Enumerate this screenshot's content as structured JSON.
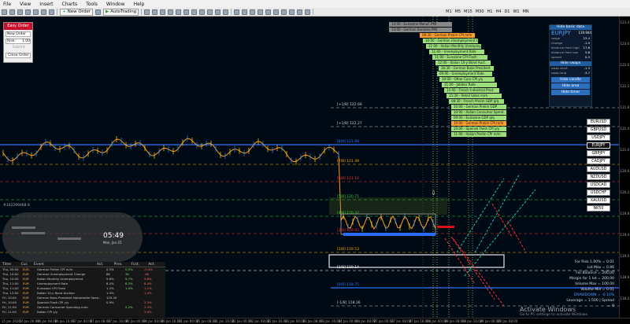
{
  "menu": [
    "File",
    "View",
    "Insert",
    "Charts",
    "Tools",
    "Window",
    "Help"
  ],
  "toolbar": {
    "new_order": "New Order",
    "auto_trading": "AutoTrading"
  },
  "timeframes": [
    "M1",
    "M5",
    "M15",
    "M30",
    "H1",
    "H4",
    "D1",
    "W1",
    "MN"
  ],
  "easy_order": {
    "title": "Easy Order",
    "type": "New Order",
    "risk_label": "Risk:",
    "risk_value": "1.00",
    "submit": "Submit",
    "close": "Close Order"
  },
  "news": [
    {
      "text": "13:00 - Eurozone Manuf. PMI",
      "color": "#888888"
    },
    {
      "text": "13:00 - German Services PMI",
      "color": "#888888"
    },
    {
      "text": "08:30 - German Prelim CPI m/m",
      "color": "#ff9f30"
    },
    {
      "text": "10:00 - German Unemployment Chan",
      "color": "#9adf7a"
    },
    {
      "text": "11:00 - Italian Monthly Unemploy.",
      "color": "#9adf7a"
    },
    {
      "text": "11:00 - Unemployment Rate",
      "color": "#9adf7a"
    },
    {
      "text": "11:00 - Eurozone CPI Flash",
      "color": "#9adf7a"
    },
    {
      "text": "12:00 - Italian 10-y Bond Auct.",
      "color": "#9adf7a"
    },
    {
      "text": "16:30 - German Bubs President",
      "color": "#9adf7a"
    },
    {
      "text": "09:00 - Unemployment Rate",
      "color": "#9adf7a"
    },
    {
      "text": "10:00 - Other Core CPI y/y",
      "color": "#9adf7a"
    },
    {
      "text": "11:00 - Jobless Rate",
      "color": "#9adf7a"
    },
    {
      "text": "15:00 - French Industrial Prod.",
      "color": "#9adf7a"
    },
    {
      "text": "15:30 - Retail Sales m/m",
      "color": "#9adf7a"
    },
    {
      "text": "08:30 - French Prelim GDP q/q",
      "color": "#9adf7a"
    },
    {
      "text": "10:00 - German Prelim GDP",
      "color": "#9adf7a"
    },
    {
      "text": "10:00 - Italian Consumer Spend.",
      "color": "#9adf7a"
    },
    {
      "text": "09:00 - Eurozone GDP q/q",
      "color": "#9adf7a"
    },
    {
      "text": "10:00 - German Prelim CPI m/m",
      "color": "#ff9f30"
    },
    {
      "text": "10:00 - Spanish Flash CPI y/y",
      "color": "#9adf7a"
    },
    {
      "text": "11:00 - Italian Prelim CPI m/m",
      "color": "#9adf7a"
    }
  ],
  "levels": [
    {
      "label": "[+1/8] 122.66",
      "color": "#cccccc"
    },
    {
      "label": "[+1/8] 122.27",
      "color": "#cccccc"
    },
    {
      "label": "[8/8] 121.88",
      "color": "#2f6fff"
    },
    {
      "label": "[7/8] 121.49",
      "color": "#ffb000"
    },
    {
      "label": "[6/8] 121.10",
      "color": "#ff3030"
    },
    {
      "label": "[5/8] 120.71",
      "color": "#3cd03c"
    },
    {
      "label": "[4/8] 120.32",
      "color": "#3cd03c"
    },
    {
      "label": "[3/8] 119.92",
      "color": "#ff3030"
    },
    {
      "label": "[2/8] 119.53",
      "color": "#ffb000"
    },
    {
      "label": "[1/8] 119.14",
      "color": "#ffffff"
    },
    {
      "label": "[0/8] 118.75",
      "color": "#2f6fff"
    },
    {
      "label": "[-1/8] 118.36",
      "color": "#cccccc"
    }
  ],
  "right_panel": {
    "hide_basic": "Hide basic data",
    "symbol": "EURJPY",
    "price": "119.944",
    "rows": [
      {
        "k": "range",
        "v": "23.4"
      },
      {
        "k": "change",
        "v": "-1.0"
      },
      {
        "k": "distance from high",
        "v": "17.6"
      },
      {
        "k": "distance from low",
        "v": "5.8"
      },
      {
        "k": "spread",
        "v": "0.3"
      }
    ],
    "hide_swaps": "Hide swaps",
    "swaps": [
      {
        "k": "swap short",
        "v": "-1.3"
      },
      {
        "k": "swap long",
        "v": "-3.7"
      }
    ],
    "buttons": [
      "Hide candle",
      "Hide area",
      "Hide timer"
    ]
  },
  "symbols": [
    "EURUSD",
    "GBPUSD",
    "USDJPY",
    "EURJPY",
    "GBPJPY",
    "CADJPY",
    "AUDUSD",
    "NZDUSD",
    "USDCAD",
    "USDCHF",
    "XAUUSD",
    "NK50"
  ],
  "selected_symbol": "EURJPY",
  "calc": [
    {
      "text": "For Risk 1.00% = 0.01",
      "blue": false
    },
    {
      "text": "Lot Max = 0.86",
      "blue": false
    },
    {
      "text": "For Balance = 200.00",
      "blue": false
    },
    {
      "text": "Margin for 1 lot = 200.00",
      "blue": false
    },
    {
      "text": "Volume Max = 100.00",
      "blue": false
    },
    {
      "text": "Volume Min = 0.01",
      "blue": false
    },
    {
      "text": "DRAWDOWN = -0.10%",
      "blue": true
    },
    {
      "text": "Leverage = 1:500 | Spread = 0",
      "blue": false
    }
  ],
  "world": {
    "clock": "05:49",
    "date": "Mon, Jan 25"
  },
  "calendar": {
    "headers": [
      "Time",
      "Cur.",
      "Event",
      "Act.",
      "Prev.",
      "Fcst.",
      "Act."
    ],
    "rows": [
      {
        "time": "Thu, 09:00",
        "cur": "EUR",
        "event": "German Prelim CPI m/m",
        "act": "0.5%",
        "prev": "0.5%",
        "fc": "-0.4%"
      },
      {
        "time": "Thu, 10:00",
        "cur": "EUR",
        "event": "German Unemployment Change",
        "act": "8K",
        "prev": "3K",
        "fc": "-8K"
      },
      {
        "time": "Thu, 10:00",
        "cur": "EUR",
        "event": "Italian Monthly Unemployment",
        "act": "9.6%",
        "prev": "9.7%",
        "fc": "9.8%"
      },
      {
        "time": "Thu, 11:00",
        "cur": "EUR",
        "event": "Unemployment Rate",
        "act": "8.4%",
        "prev": "8.3%",
        "fc": "8.4%"
      },
      {
        "time": "Thu, 11:00",
        "cur": "EUR",
        "event": "Eurozone CPI Flash",
        "act": "1.2%",
        "prev": "1.0%",
        "fc": "1.1%"
      },
      {
        "time": "Thu, 12:00",
        "cur": "EUR",
        "event": "Italian 10-y Bond Auction",
        "act": "1.3%",
        "prev": "",
        "fc": "1.4%"
      },
      {
        "time": "Fri, 10:00",
        "cur": "EUR",
        "event": "German Bubs President Nationwide Spea...",
        "act": "125.2K",
        "prev": "",
        "fc": ""
      },
      {
        "time": "Fri, 10:00",
        "cur": "EUR",
        "event": "Spanish Flash CPI y/y",
        "act": "0.9%",
        "prev": "",
        "fc": "2.3%"
      },
      {
        "time": "Fri, 11:00",
        "cur": "EUR",
        "event": "German Consumer Spending m/m",
        "act": "",
        "prev": "2.2%",
        "fc": "2.3%"
      },
      {
        "time": "Fri, 11:00",
        "cur": "EUR",
        "event": "Italian CPI y/y",
        "act": "",
        "prev": "",
        "fc": "2.0%"
      }
    ]
  },
  "chart_title_left": "#102299468 8",
  "x_ticks": [
    "15 Jan 2020",
    "16 Jan 00:00",
    "16 Jan 08:00",
    "16 Jan 16:00",
    "17 Jan 00:00",
    "17 Jan 08:00",
    "17 Jan 16:00",
    "20 Jan 00:00",
    "20 Jan 08:00",
    "20 Jan 16:00",
    "21 Jan 00:00",
    "21 Jan 08:00",
    "21 Jan 16:00",
    "22 Jan 00:00",
    "22 Jan 08:00",
    "22 Jan 16:00",
    "23 Jan 00:00",
    "23 Jan 08:00",
    "23 Jan 16:00",
    "24 Jan 00:00",
    "24 Jan 08:00",
    "27 Jan 00:00",
    "27 Jan 08:00",
    "27 Jan 16:00",
    "28 Jan 00:00",
    "28 Jan 08:00",
    "28 Jan 16:00",
    "29 Jan 00:00",
    "29 Jan 08:00"
  ],
  "activate": {
    "title": "Activate Windows",
    "sub": "Go to PC settings to activate Windows."
  }
}
